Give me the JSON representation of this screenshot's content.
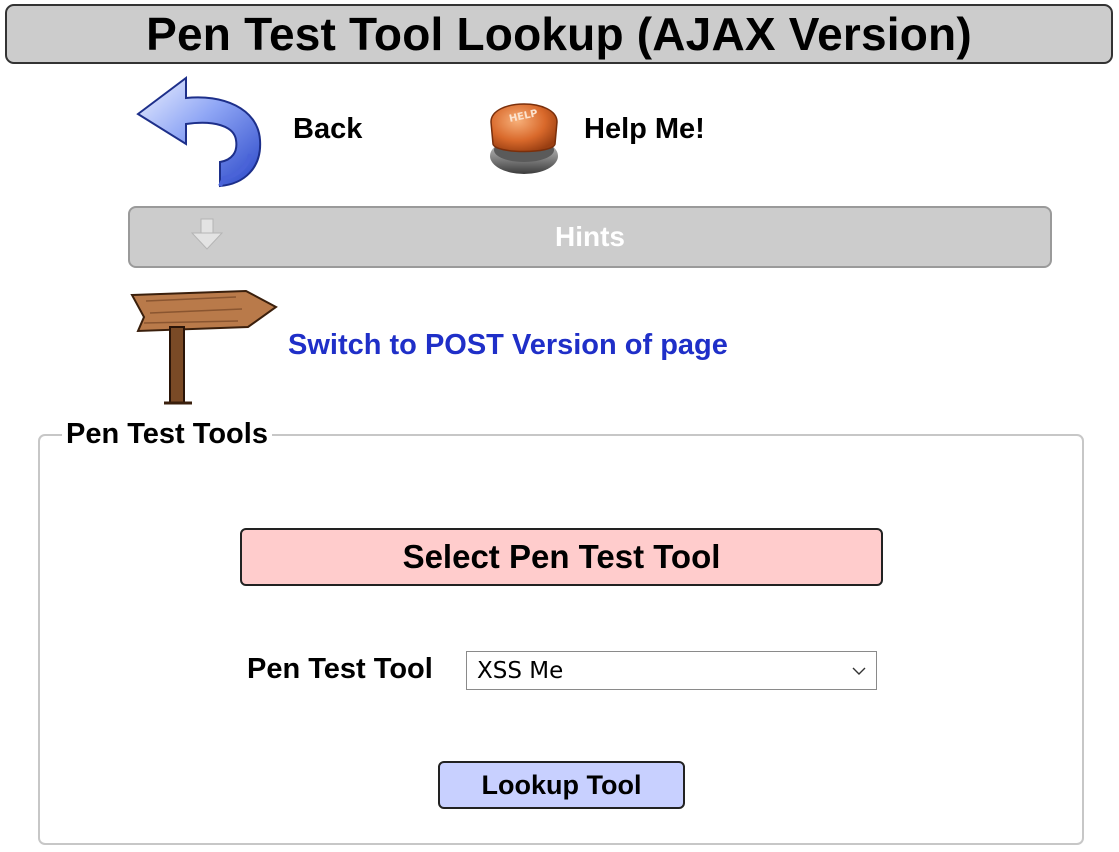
{
  "header": {
    "title": "Pen Test Tool Lookup (AJAX Version)"
  },
  "nav": {
    "back_label": "Back",
    "back_icon": "back-arrow-icon",
    "help_label": "Help Me!",
    "help_icon": "help-button-icon",
    "help_icon_text": "HELP"
  },
  "hints": {
    "label": "Hints",
    "icon": "down-arrow-icon"
  },
  "switch": {
    "icon": "signpost-icon",
    "link_text": "Switch to POST Version of page"
  },
  "form": {
    "legend": "Pen Test Tools",
    "header": "Select Pen Test Tool",
    "field_label": "Pen Test Tool",
    "selected_value": "XSS Me",
    "submit_label": "Lookup Tool"
  },
  "colors": {
    "title_bar_bg": "#cccccc",
    "hints_bg": "#cccccc",
    "link_color": "#1f2fc8",
    "form_header_bg": "#ffcccc",
    "button_bg": "#c8d0ff"
  }
}
